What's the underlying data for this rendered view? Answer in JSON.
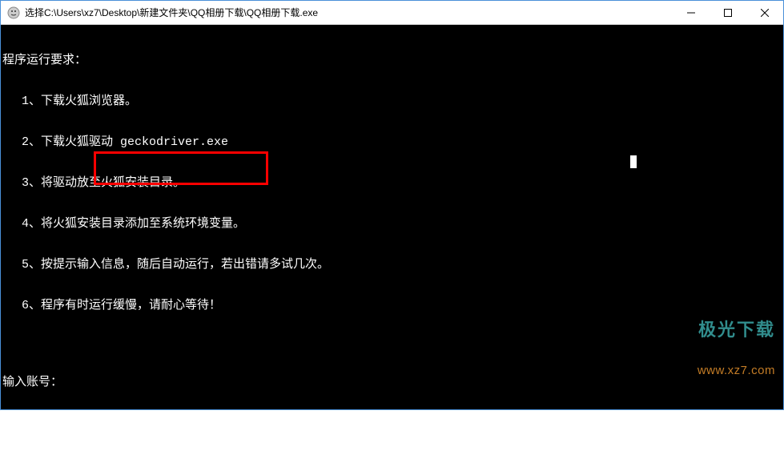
{
  "window": {
    "title": "选择C:\\Users\\xz7\\Desktop\\新建文件夹\\QQ相册下载\\QQ相册下载.exe",
    "controls": {
      "minimize": "—",
      "maximize": "□",
      "close": "✕"
    }
  },
  "console": {
    "header": "程序运行要求：",
    "lines": [
      "1、下载火狐浏览器。",
      "2、下载火狐驱动 geckodriver.exe",
      "3、将驱动放至火狐安装目录。",
      "4、将火狐安装目录添加至系统环境变量。",
      "5、按提示输入信息，随后自动运行，若出错请多试几次。",
      "6、程序有时运行缓慢，请耐心等待！"
    ],
    "prompt": "输入账号：",
    "input_value": ""
  },
  "watermark": {
    "brand": "极光下载",
    "url": "www.xz7.com"
  }
}
